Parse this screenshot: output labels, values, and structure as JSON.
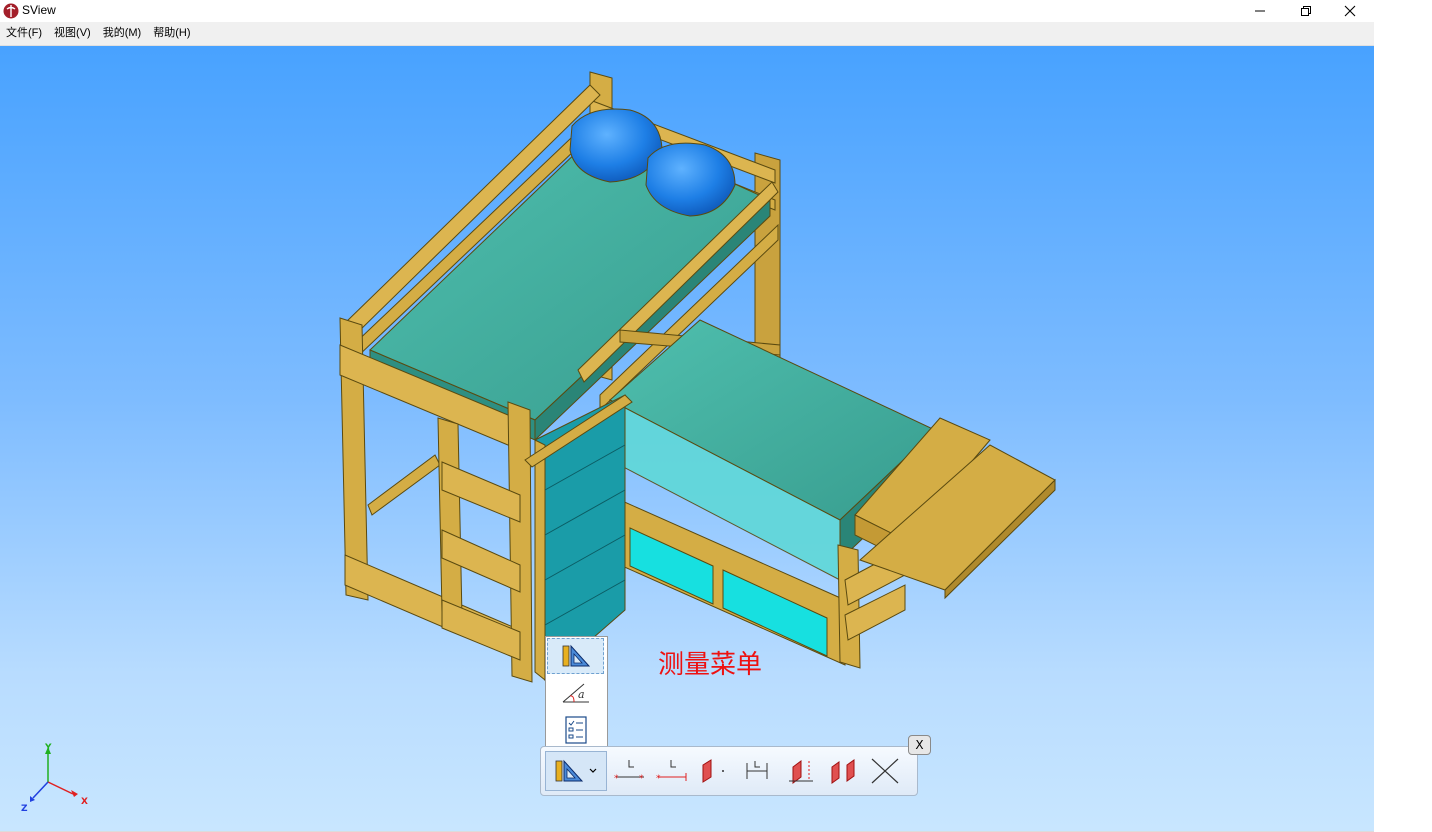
{
  "window": {
    "title": "SView",
    "controls": [
      "minimize-icon",
      "restore-icon",
      "close-icon"
    ]
  },
  "menu": {
    "items": [
      "文件(F)",
      "视图(V)",
      "我的(M)",
      "帮助(H)"
    ]
  },
  "annotation": {
    "text": "测量菜单",
    "color": "#ee1111"
  },
  "measure_dropdown": {
    "items": [
      {
        "icon": "ruler-triangle-icon",
        "selected": true
      },
      {
        "icon": "angle-measure-icon",
        "selected": false
      },
      {
        "icon": "property-list-icon",
        "selected": false
      }
    ]
  },
  "measure_toolbar": {
    "main_icon": "ruler-triangle-icon",
    "tools": [
      "point-to-point-distance-icon",
      "point-to-line-distance-icon",
      "point-to-plane-distance-icon",
      "line-to-line-distance-icon",
      "line-to-plane-distance-icon",
      "plane-to-plane-distance-icon",
      "cross-line-icon"
    ],
    "close_label": "X"
  },
  "axes": {
    "x": "X",
    "y": "Y",
    "z": "Z",
    "colors": {
      "x": "#e02020",
      "y": "#20b020",
      "z": "#2040e0"
    }
  },
  "colors": {
    "viewport_top": "#48a2ff",
    "viewport_bottom": "#c8e6ff",
    "wood": "#d4ad45",
    "mattress": "#3fae9f",
    "drawer": "#1a9ca8",
    "pillow": "#1e7fe6"
  }
}
